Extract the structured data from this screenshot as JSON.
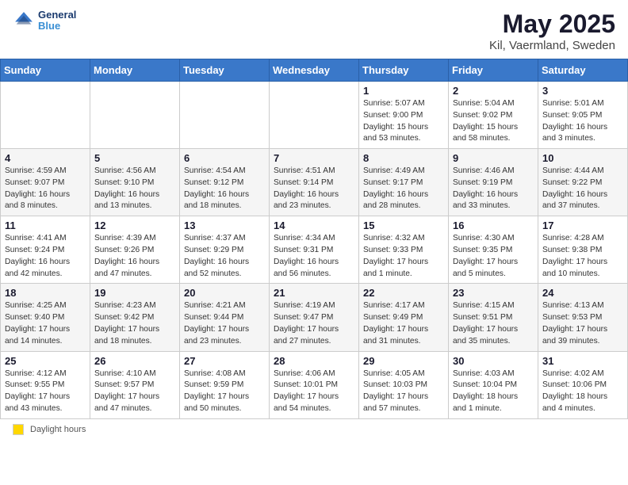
{
  "header": {
    "logo_line1": "General",
    "logo_line2": "Blue",
    "title": "May 2025",
    "subtitle": "Kil, Vaermland, Sweden"
  },
  "days_of_week": [
    "Sunday",
    "Monday",
    "Tuesday",
    "Wednesday",
    "Thursday",
    "Friday",
    "Saturday"
  ],
  "weeks": [
    [
      {
        "day": "",
        "info": ""
      },
      {
        "day": "",
        "info": ""
      },
      {
        "day": "",
        "info": ""
      },
      {
        "day": "",
        "info": ""
      },
      {
        "day": "1",
        "info": "Sunrise: 5:07 AM\nSunset: 9:00 PM\nDaylight: 15 hours\nand 53 minutes."
      },
      {
        "day": "2",
        "info": "Sunrise: 5:04 AM\nSunset: 9:02 PM\nDaylight: 15 hours\nand 58 minutes."
      },
      {
        "day": "3",
        "info": "Sunrise: 5:01 AM\nSunset: 9:05 PM\nDaylight: 16 hours\nand 3 minutes."
      }
    ],
    [
      {
        "day": "4",
        "info": "Sunrise: 4:59 AM\nSunset: 9:07 PM\nDaylight: 16 hours\nand 8 minutes."
      },
      {
        "day": "5",
        "info": "Sunrise: 4:56 AM\nSunset: 9:10 PM\nDaylight: 16 hours\nand 13 minutes."
      },
      {
        "day": "6",
        "info": "Sunrise: 4:54 AM\nSunset: 9:12 PM\nDaylight: 16 hours\nand 18 minutes."
      },
      {
        "day": "7",
        "info": "Sunrise: 4:51 AM\nSunset: 9:14 PM\nDaylight: 16 hours\nand 23 minutes."
      },
      {
        "day": "8",
        "info": "Sunrise: 4:49 AM\nSunset: 9:17 PM\nDaylight: 16 hours\nand 28 minutes."
      },
      {
        "day": "9",
        "info": "Sunrise: 4:46 AM\nSunset: 9:19 PM\nDaylight: 16 hours\nand 33 minutes."
      },
      {
        "day": "10",
        "info": "Sunrise: 4:44 AM\nSunset: 9:22 PM\nDaylight: 16 hours\nand 37 minutes."
      }
    ],
    [
      {
        "day": "11",
        "info": "Sunrise: 4:41 AM\nSunset: 9:24 PM\nDaylight: 16 hours\nand 42 minutes."
      },
      {
        "day": "12",
        "info": "Sunrise: 4:39 AM\nSunset: 9:26 PM\nDaylight: 16 hours\nand 47 minutes."
      },
      {
        "day": "13",
        "info": "Sunrise: 4:37 AM\nSunset: 9:29 PM\nDaylight: 16 hours\nand 52 minutes."
      },
      {
        "day": "14",
        "info": "Sunrise: 4:34 AM\nSunset: 9:31 PM\nDaylight: 16 hours\nand 56 minutes."
      },
      {
        "day": "15",
        "info": "Sunrise: 4:32 AM\nSunset: 9:33 PM\nDaylight: 17 hours\nand 1 minute."
      },
      {
        "day": "16",
        "info": "Sunrise: 4:30 AM\nSunset: 9:35 PM\nDaylight: 17 hours\nand 5 minutes."
      },
      {
        "day": "17",
        "info": "Sunrise: 4:28 AM\nSunset: 9:38 PM\nDaylight: 17 hours\nand 10 minutes."
      }
    ],
    [
      {
        "day": "18",
        "info": "Sunrise: 4:25 AM\nSunset: 9:40 PM\nDaylight: 17 hours\nand 14 minutes."
      },
      {
        "day": "19",
        "info": "Sunrise: 4:23 AM\nSunset: 9:42 PM\nDaylight: 17 hours\nand 18 minutes."
      },
      {
        "day": "20",
        "info": "Sunrise: 4:21 AM\nSunset: 9:44 PM\nDaylight: 17 hours\nand 23 minutes."
      },
      {
        "day": "21",
        "info": "Sunrise: 4:19 AM\nSunset: 9:47 PM\nDaylight: 17 hours\nand 27 minutes."
      },
      {
        "day": "22",
        "info": "Sunrise: 4:17 AM\nSunset: 9:49 PM\nDaylight: 17 hours\nand 31 minutes."
      },
      {
        "day": "23",
        "info": "Sunrise: 4:15 AM\nSunset: 9:51 PM\nDaylight: 17 hours\nand 35 minutes."
      },
      {
        "day": "24",
        "info": "Sunrise: 4:13 AM\nSunset: 9:53 PM\nDaylight: 17 hours\nand 39 minutes."
      }
    ],
    [
      {
        "day": "25",
        "info": "Sunrise: 4:12 AM\nSunset: 9:55 PM\nDaylight: 17 hours\nand 43 minutes."
      },
      {
        "day": "26",
        "info": "Sunrise: 4:10 AM\nSunset: 9:57 PM\nDaylight: 17 hours\nand 47 minutes."
      },
      {
        "day": "27",
        "info": "Sunrise: 4:08 AM\nSunset: 9:59 PM\nDaylight: 17 hours\nand 50 minutes."
      },
      {
        "day": "28",
        "info": "Sunrise: 4:06 AM\nSunset: 10:01 PM\nDaylight: 17 hours\nand 54 minutes."
      },
      {
        "day": "29",
        "info": "Sunrise: 4:05 AM\nSunset: 10:03 PM\nDaylight: 17 hours\nand 57 minutes."
      },
      {
        "day": "30",
        "info": "Sunrise: 4:03 AM\nSunset: 10:04 PM\nDaylight: 18 hours\nand 1 minute."
      },
      {
        "day": "31",
        "info": "Sunrise: 4:02 AM\nSunset: 10:06 PM\nDaylight: 18 hours\nand 4 minutes."
      }
    ]
  ],
  "footer": {
    "legend_label": "Daylight hours"
  }
}
